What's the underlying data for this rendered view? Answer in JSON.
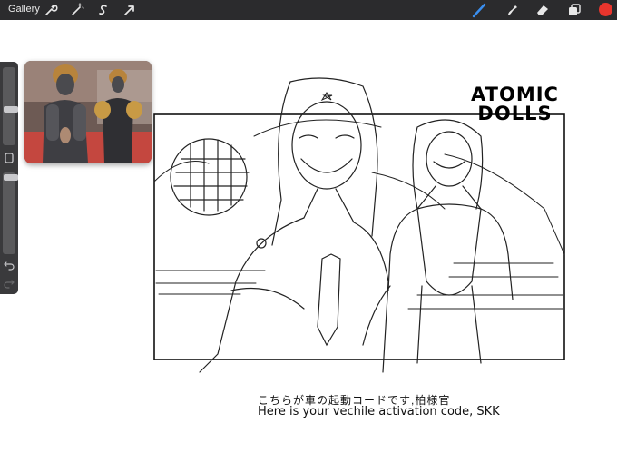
{
  "toolbar": {
    "gallery_label": "Gallery",
    "left_icons": [
      "wrench-icon",
      "magic-wand-icon",
      "selection-s-icon",
      "transform-arrow-icon"
    ],
    "right_icons": [
      "brush-icon",
      "smudge-icon",
      "eraser-icon",
      "layers-icon"
    ],
    "current_color": "#e8352d"
  },
  "sidebar": {
    "size_slider_level": 0.45,
    "opacity_slider_level": 0.97,
    "modify_button": "square-modify-icon",
    "undo_icon": "undo-icon",
    "redo_icon": "redo-icon"
  },
  "reference_window": {
    "icon": "reference-photo-thumbnail"
  },
  "artwork": {
    "title_line1": "ATOMIC",
    "title_line2": "DOLLS",
    "caption_japanese": "こちらが車の起動コードです,柏様官",
    "caption_english": "Here is your vechile activation code, SKK"
  }
}
